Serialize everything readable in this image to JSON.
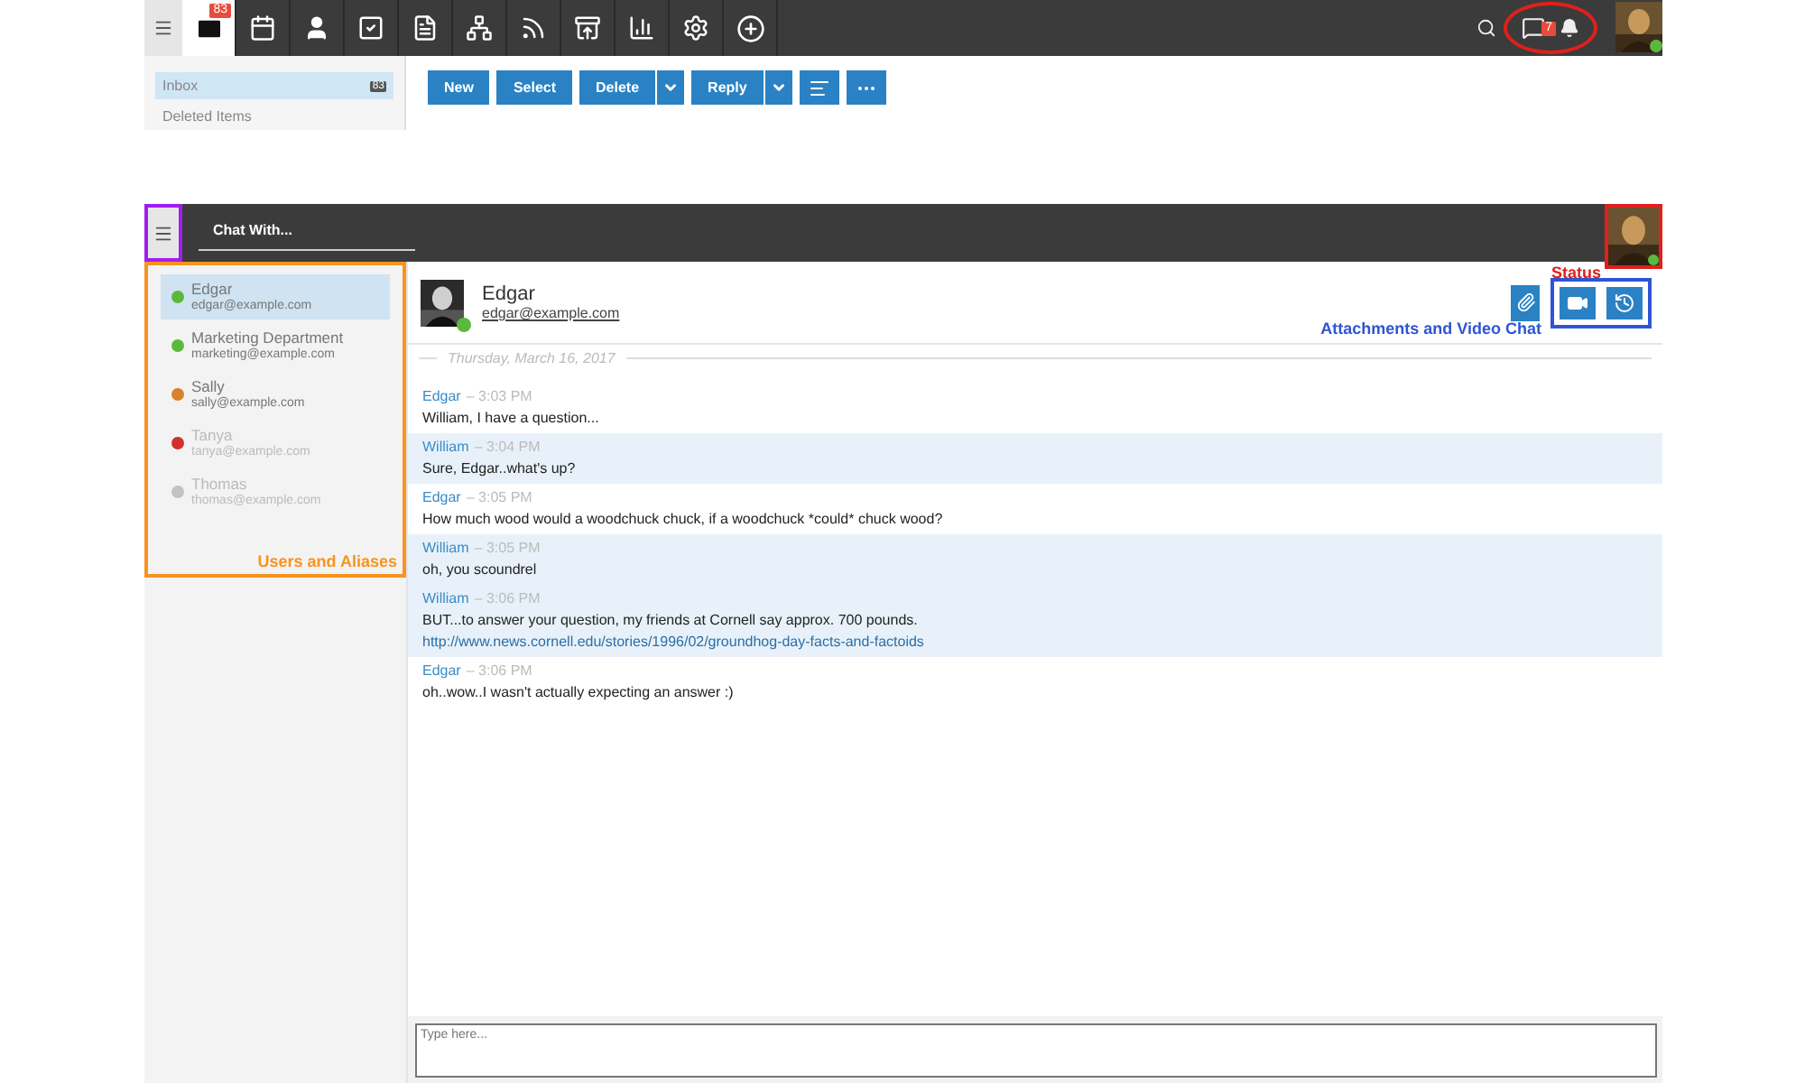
{
  "mail_view": {
    "nav_tabs": [
      {
        "kind": "mail",
        "selected": true,
        "badge": "83"
      },
      {
        "kind": "calendar",
        "selected": false
      },
      {
        "kind": "contacts",
        "selected": false
      },
      {
        "kind": "tasks",
        "selected": false
      },
      {
        "kind": "notes",
        "selected": false
      },
      {
        "kind": "org",
        "selected": false
      },
      {
        "kind": "rss",
        "selected": false
      },
      {
        "kind": "inbox",
        "selected": false
      },
      {
        "kind": "reports",
        "selected": false
      },
      {
        "kind": "settings",
        "selected": false
      },
      {
        "kind": "add",
        "selected": false
      }
    ],
    "chat_badge": "7",
    "folders": [
      {
        "label": "Inbox",
        "count": "83",
        "selected": true
      },
      {
        "label": "Deleted Items",
        "selected": false
      }
    ],
    "toolbar": [
      {
        "kind": "text",
        "label": "New",
        "dropdown": false
      },
      {
        "kind": "text",
        "label": "Select",
        "dropdown": false
      },
      {
        "kind": "text",
        "label": "Delete",
        "dropdown": true
      },
      {
        "kind": "text",
        "label": "Reply",
        "dropdown": true
      },
      {
        "kind": "sort",
        "dropdown": false
      },
      {
        "kind": "more",
        "dropdown": false
      }
    ]
  },
  "chat": {
    "search": {
      "placeholder": "Chat With..."
    },
    "contacts": [
      {
        "name": "Edgar",
        "email": "edgar@example.com",
        "color": "#5cb83c",
        "selected": true,
        "dimmed": false
      },
      {
        "name": "Marketing Department",
        "email": "marketing@example.com",
        "color": "#5cb83c",
        "selected": false,
        "dimmed": false
      },
      {
        "name": "Sally",
        "email": "sally@example.com",
        "color": "#d9822b",
        "selected": false,
        "dimmed": false
      },
      {
        "name": "Tanya",
        "email": "tanya@example.com",
        "color": "#d32f2f",
        "selected": false,
        "dimmed": true
      },
      {
        "name": "Thomas",
        "email": "thomas@example.com",
        "color": "#c2c2c2",
        "selected": false,
        "dimmed": true
      }
    ],
    "header": {
      "name": "Edgar",
      "email": "edgar@example.com"
    },
    "date": "Thursday, March 16, 2017",
    "messages": [
      {
        "author": "Edgar",
        "time": "– 3:03 PM",
        "text": "William, I have a question...",
        "own": false
      },
      {
        "author": "William",
        "time": "– 3:04 PM",
        "text": "Sure, Edgar..what's up?",
        "own": true
      },
      {
        "author": "Edgar",
        "time": "– 3:05 PM",
        "text": "How much wood would a woodchuck chuck, if a woodchuck *could* chuck wood?",
        "own": false
      },
      {
        "author": "William",
        "time": "– 3:05 PM",
        "text": "oh, you scoundrel",
        "own": true
      },
      {
        "author": "William",
        "time": "– 3:06 PM",
        "text": "BUT...to answer your question, my friends at Cornell say approx. 700 pounds.",
        "link": "http://www.news.cornell.edu/stories/1996/02/groundhog-day-facts-and-factoids",
        "own": true
      },
      {
        "author": "Edgar",
        "time": "– 3:06 PM",
        "text": "oh..wow..I wasn't actually expecting an answer :)",
        "own": false
      }
    ],
    "composer": {
      "placeholder": "Type here..."
    }
  },
  "annotations": [
    {
      "kind": "menu",
      "color": "#a21cf0"
    },
    {
      "kind": "contacts",
      "label": "Users and Aliases",
      "color": "#f7931e"
    },
    {
      "kind": "status",
      "label": "Status",
      "color": "#e0201b"
    },
    {
      "kind": "video",
      "label": "Attachments and Video Chat",
      "color": "#2f55d4"
    },
    {
      "kind": "chaticon",
      "color": "#e0201b"
    }
  ]
}
